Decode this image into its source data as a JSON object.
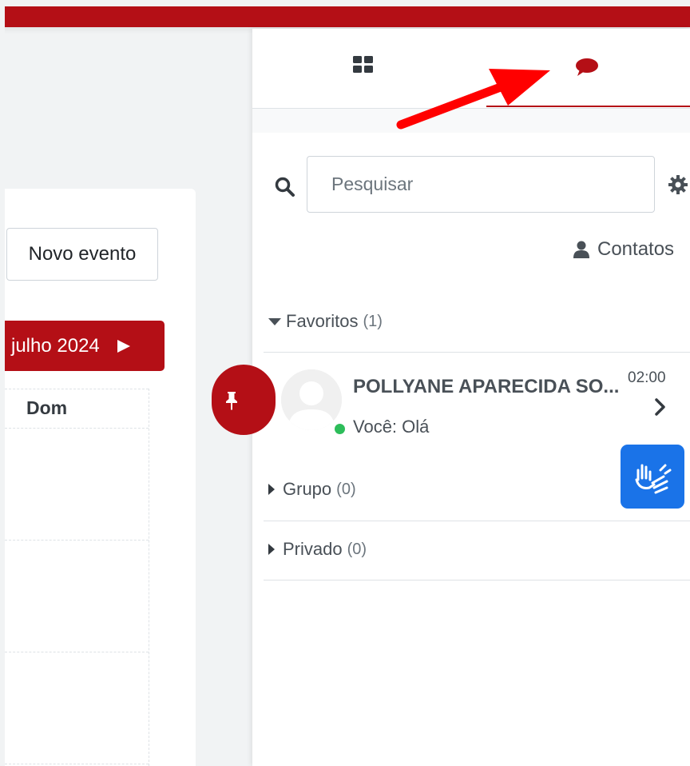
{
  "calendar": {
    "new_event_label": "Novo evento",
    "month_label": "julho 2024",
    "day_header": "Dom"
  },
  "drawer": {
    "search": {
      "placeholder": "Pesquisar",
      "value": ""
    },
    "contacts_label": "Contatos",
    "sections": {
      "favorites": {
        "label": "Favoritos",
        "count": "(1)"
      },
      "group": {
        "label": "Grupo",
        "count": "(0)"
      },
      "private": {
        "label": "Privado",
        "count": "(0)"
      }
    },
    "conversation": {
      "name": "POLLYANE APARECIDA SO...",
      "time": "02:00",
      "preview": "Você: Olá",
      "online": true
    }
  },
  "colors": {
    "brand": "#b40f16",
    "online": "#2dbd5a",
    "vlibras": "#1a73e8",
    "annotation_arrow": "#ff0000"
  },
  "icons": {
    "tab_overview": "grid-icon",
    "tab_messages": "chat-bubble-icon",
    "pin": "thumbtack-icon",
    "search": "search-icon",
    "settings": "gear-icon",
    "contacts": "user-icon",
    "accessibility": "sign-language-icon"
  }
}
